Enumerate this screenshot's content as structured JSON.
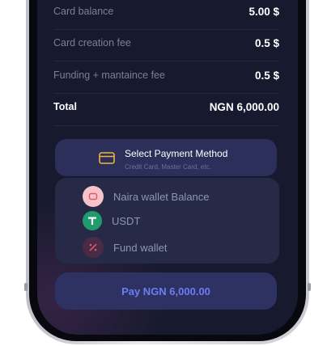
{
  "summary": {
    "rows": [
      {
        "label": "Card balance",
        "value": "5.00 $"
      },
      {
        "label": "Card creation fee",
        "value": "0.5 $"
      },
      {
        "label": "Funding + mantaince fee",
        "value": "0.5 $"
      }
    ],
    "total": {
      "label": "Total",
      "value": "NGN 6,000.00"
    }
  },
  "payment_method": {
    "title": "Select Payment Method",
    "subtitle": "Credit Card, Master Card, etc.",
    "icon": "card-icon"
  },
  "options": [
    {
      "label": "Naira wallet Balance",
      "icon": "wallet-icon"
    },
    {
      "label": "USDT",
      "icon": "tether-icon"
    },
    {
      "label": "Fund wallet",
      "icon": "fund-icon"
    }
  ],
  "pay_button": {
    "label": "Pay NGN 6,000.00"
  },
  "colors": {
    "screen_bg": "#171a2e",
    "card_bg": "#2b2f5a",
    "options_bg": "#262a47",
    "pay_button_text": "#6c7df5",
    "card_icon": "#f2b542",
    "usdt_green": "#1f9b6e"
  }
}
